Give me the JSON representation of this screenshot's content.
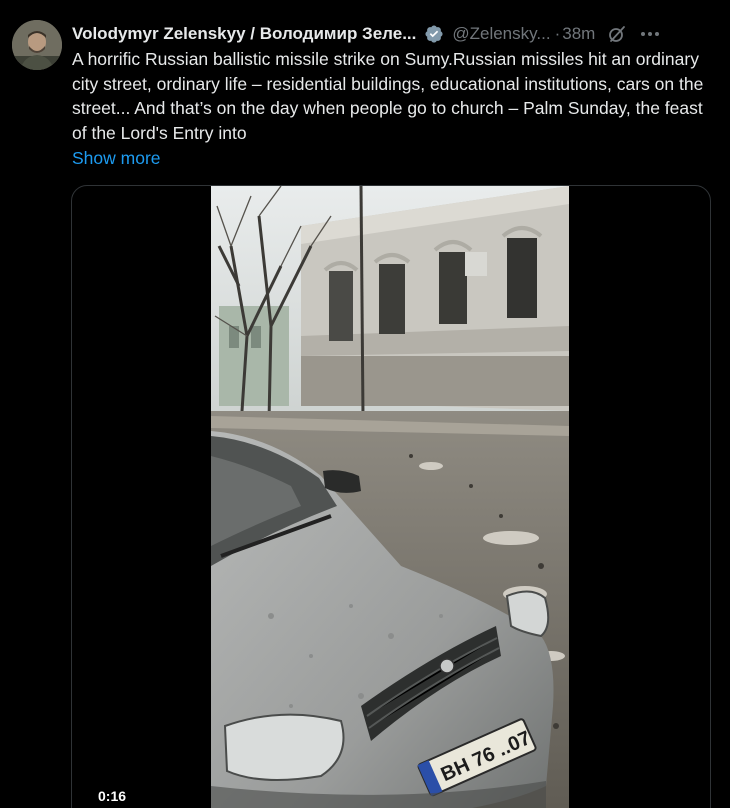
{
  "author": {
    "display_name": "Volodymyr Zelenskyy / Володимир Зеле...",
    "handle": "@Zelensky...",
    "separator": "·",
    "timestamp": "38m"
  },
  "icons": {
    "verified": "verified-badge-icon",
    "grok": "grok-icon",
    "more": "more-options-icon"
  },
  "tweet": {
    "text": "A horrific Russian ballistic missile strike on Sumy.Russian missiles hit an ordinary city street, ordinary life – residential buildings, educational institutions, cars on the street... And that’s on the day when people go to church – Palm Sunday, the feast of the Lord's Entry into",
    "show_more_label": "Show more"
  },
  "media": {
    "type": "video",
    "time_label": "0:16",
    "license_plate": "ВН 76 ..07"
  },
  "colors": {
    "background": "#000000",
    "text_primary": "#e7e9ea",
    "text_secondary": "#71767b",
    "link": "#1d9bf0",
    "border": "#2f3336"
  }
}
